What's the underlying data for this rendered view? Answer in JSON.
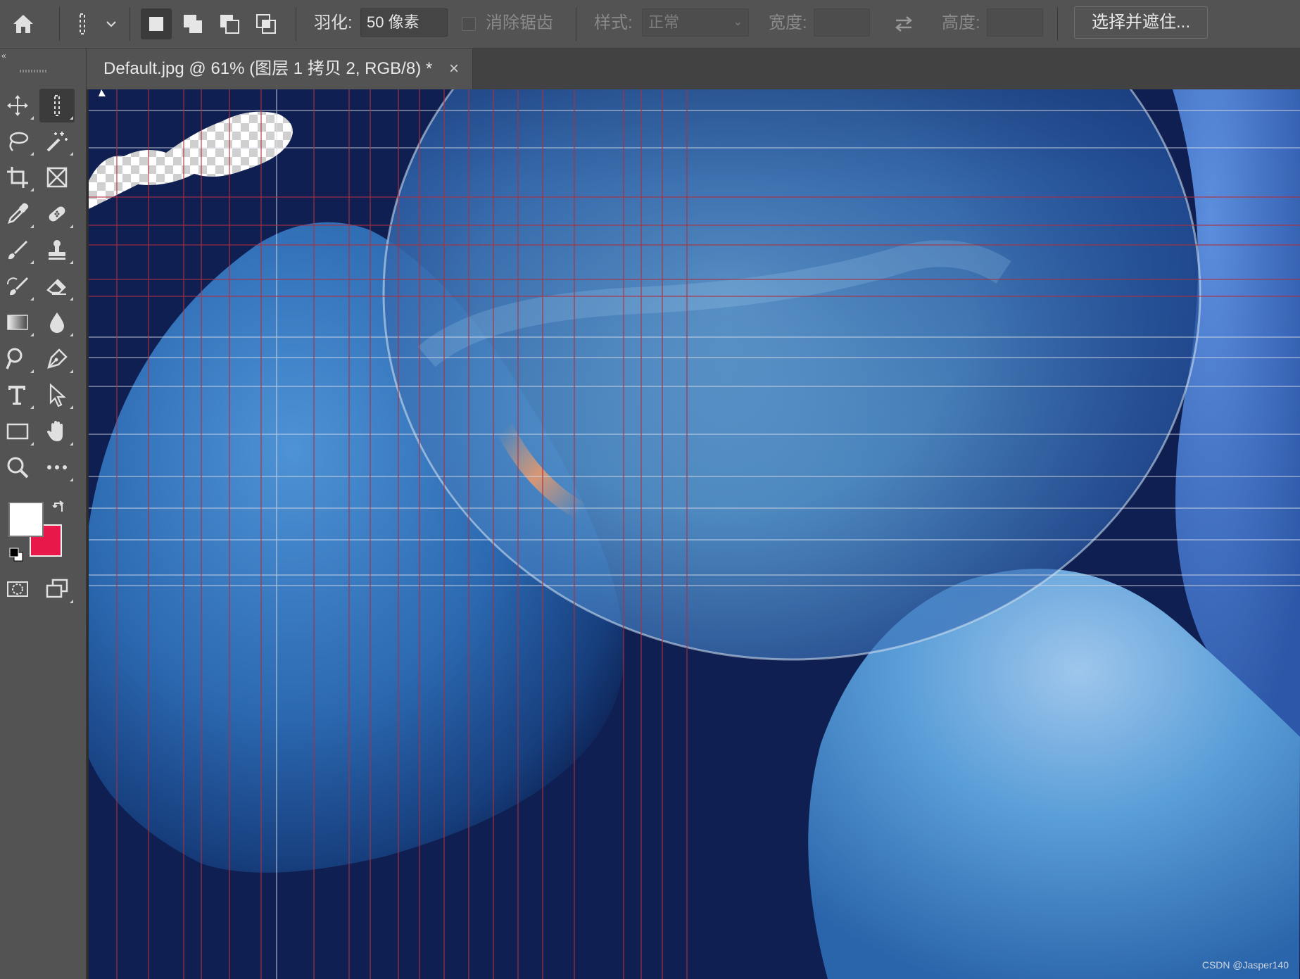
{
  "options_bar": {
    "feather_label": "羽化:",
    "feather_value": "50 像素",
    "antialias_label": "消除锯齿",
    "style_label": "样式:",
    "style_value": "正常",
    "width_label": "宽度:",
    "height_label": "高度:",
    "select_mask_label": "选择并遮住..."
  },
  "document_tab": {
    "title": "Default.jpg @ 61% (图层 1 拷贝 2, RGB/8) *",
    "close": "×"
  },
  "toolbar": {
    "tools": [
      "move-tool",
      "marquee-tool",
      "lasso-tool",
      "magic-wand-tool",
      "crop-tool",
      "frame-tool",
      "eyedropper-tool",
      "healing-brush-tool",
      "brush-tool",
      "clone-stamp-tool",
      "history-brush-tool",
      "eraser-tool",
      "gradient-tool",
      "blur-tool",
      "dodge-tool",
      "pen-tool",
      "type-tool",
      "path-selection-tool",
      "rectangle-tool",
      "hand-tool",
      "zoom-tool",
      "more-tools"
    ],
    "foreground_color": "#ffffff",
    "background_color": "#e8194a"
  },
  "canvas": {
    "watermark": "CSDN @Jasper140"
  }
}
